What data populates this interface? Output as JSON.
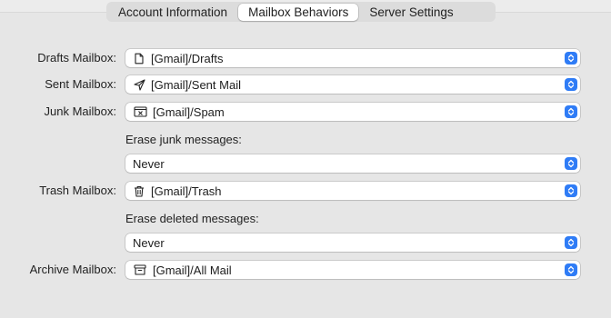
{
  "tabs": [
    {
      "label": "Account Information",
      "selected": false
    },
    {
      "label": "Mailbox Behaviors",
      "selected": true
    },
    {
      "label": "Server Settings",
      "selected": false
    }
  ],
  "rows": {
    "drafts": {
      "label": "Drafts Mailbox:",
      "value": "[Gmail]/Drafts",
      "icon": "draft-document-icon"
    },
    "sent": {
      "label": "Sent Mailbox:",
      "value": "[Gmail]/Sent Mail",
      "icon": "paper-plane-icon"
    },
    "junk": {
      "label": "Junk Mailbox:",
      "value": "[Gmail]/Spam",
      "icon": "junk-tray-icon"
    },
    "erase_junk": {
      "label": "Erase junk messages:",
      "value": "Never"
    },
    "trash": {
      "label": "Trash Mailbox:",
      "value": "[Gmail]/Trash",
      "icon": "trash-can-icon"
    },
    "erase_deleted": {
      "label": "Erase deleted messages:",
      "value": "Never"
    },
    "archive": {
      "label": "Archive Mailbox:",
      "value": "[Gmail]/All Mail",
      "icon": "archive-box-icon"
    }
  },
  "colors": {
    "accent": "#2f7cf6",
    "background": "#e6e6e6"
  }
}
